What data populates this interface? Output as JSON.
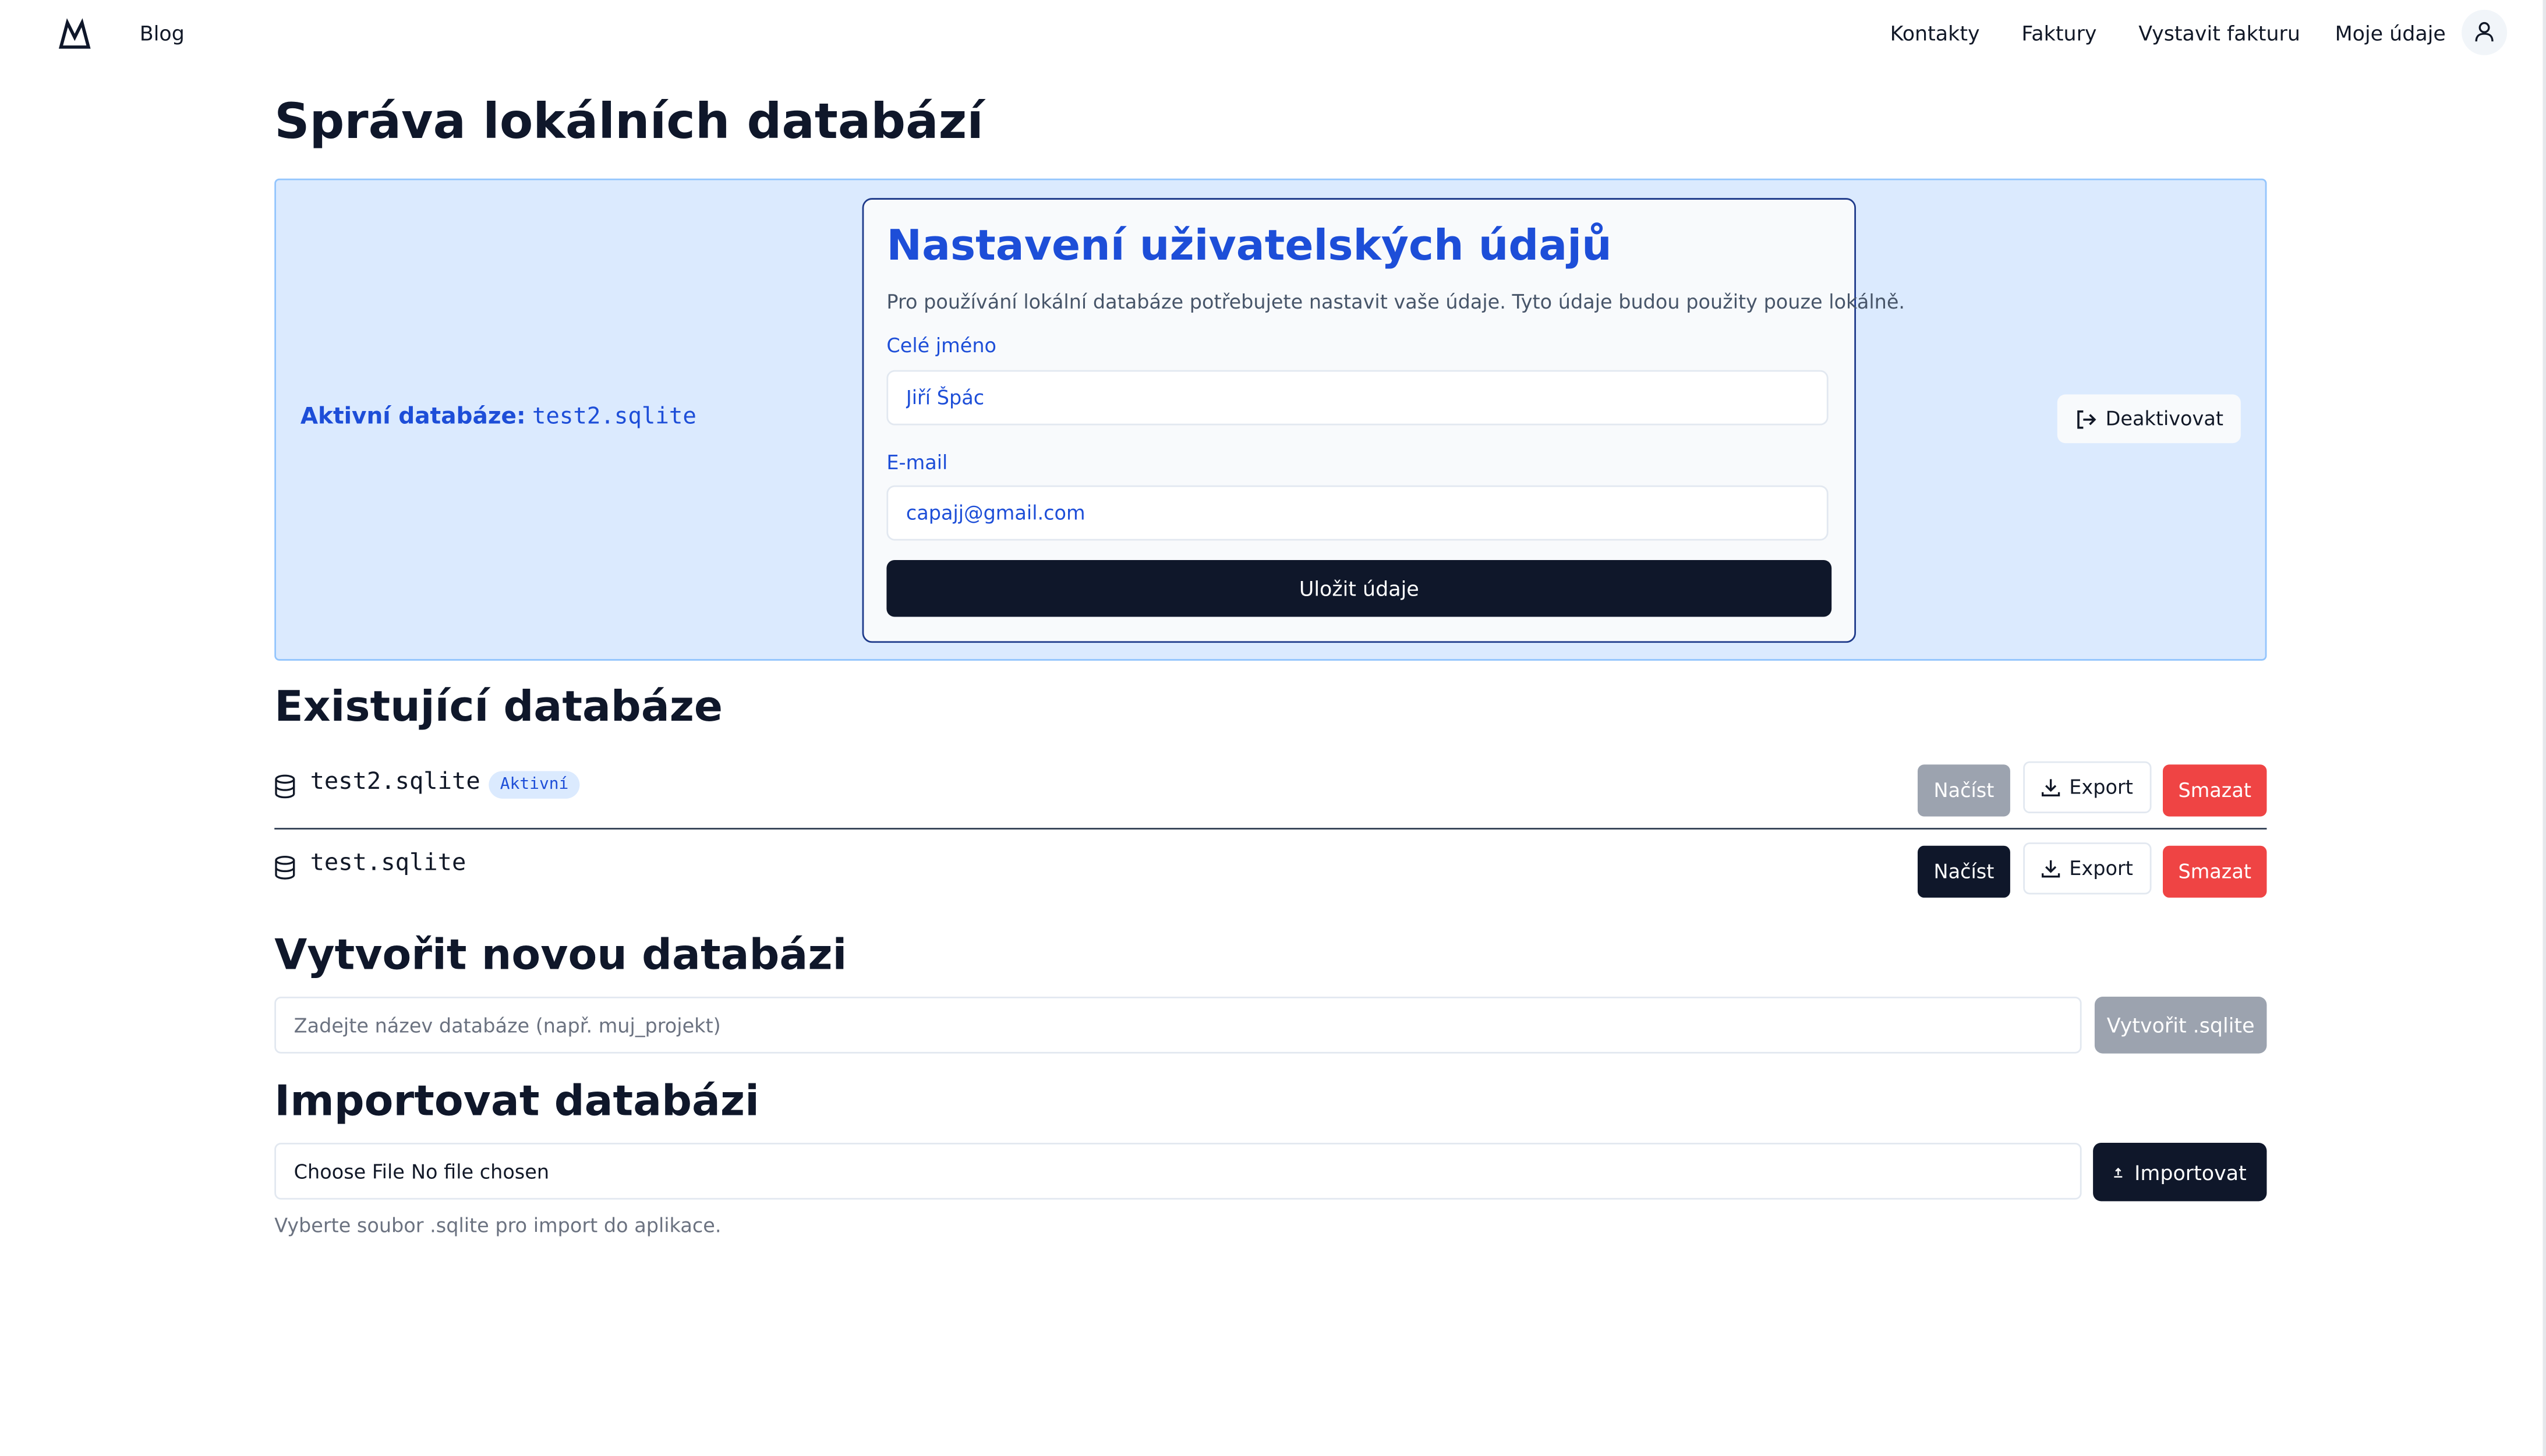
{
  "nav": {
    "blog": "Blog",
    "contacts": "Kontakty",
    "invoices": "Faktury",
    "issue_invoice": "Vystavit fakturu",
    "my_details": "Moje údaje"
  },
  "page": {
    "title": "Správa lokálních databází"
  },
  "active": {
    "label": "Aktivní databáze:",
    "db_name": "test2.sqlite",
    "deactivate": "Deaktivovat"
  },
  "settings": {
    "title": "Nastavení uživatelských údajů",
    "description": "Pro používání lokální databáze potřebujete nastavit vaše údaje. Tyto údaje budou použity pouze lokálně.",
    "name_label": "Celé jméno",
    "name_value": "Jiří Špác",
    "email_label": "E-mail",
    "email_value": "capajj@gmail.com",
    "save": "Uložit údaje"
  },
  "existing": {
    "title": "Existující databáze",
    "items": [
      {
        "name": "test2.sqlite",
        "badge": "Aktivní",
        "load": "Načíst",
        "export": "Export",
        "delete": "Smazat",
        "load_enabled": false
      },
      {
        "name": "test.sqlite",
        "badge": "",
        "load": "Načíst",
        "export": "Export",
        "delete": "Smazat",
        "load_enabled": true
      }
    ]
  },
  "create": {
    "title": "Vytvořit novou databázi",
    "placeholder": "Zadejte název databáze (např. muj_projekt)",
    "button": "Vytvořit .sqlite"
  },
  "import": {
    "title": "Importovat databázi",
    "choose_file": "Choose File",
    "file_status": "No file chosen",
    "button": "Importovat",
    "help": "Vyberte soubor .sqlite pro import do aplikace."
  },
  "colors": {
    "accent": "#1d4ed8",
    "panel_bg": "#dbeafe",
    "primary_button": "#0f172a",
    "danger": "#ef4444",
    "disabled_button": "#9ca3af"
  }
}
